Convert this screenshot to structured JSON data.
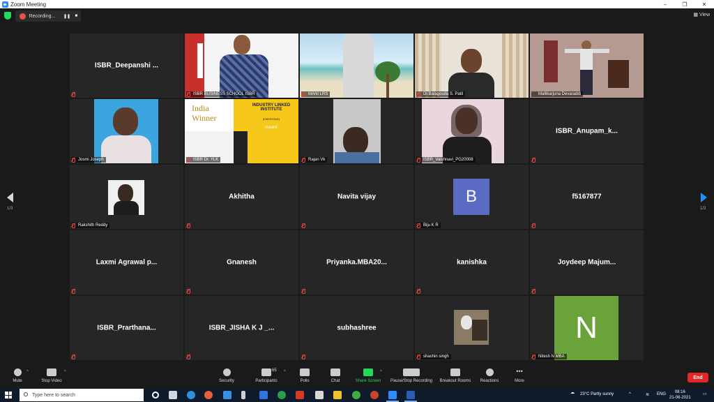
{
  "window": {
    "title": "Zoom Meeting",
    "controls": [
      "–",
      "❐",
      "✕"
    ]
  },
  "recording": {
    "label": "Recording...",
    "pause": "❚❚",
    "stop": "■"
  },
  "view_button": "View",
  "pager": {
    "left": "1/3",
    "right": "1/3"
  },
  "tiles": [
    {
      "center": "ISBR_Deepanshi ...",
      "label": ""
    },
    {
      "center": "",
      "label": "ISBR BUSINESS SCHOOL ISBR"
    },
    {
      "center": "",
      "label": "MANI LRS"
    },
    {
      "center": "",
      "label": "Dr.Balagouda S. Patil"
    },
    {
      "center": "",
      "label": "Mallikarjuna Devaraddi"
    },
    {
      "center": "",
      "label": "Josmi Joseph"
    },
    {
      "center": "",
      "label": "ISBR Dr. YLK",
      "poster_a": "India Winner",
      "poster_b": "INDUSTRY LINKED INSTITUTE",
      "poster_c": "(EMERGING)",
      "poster_d": "Award"
    },
    {
      "center": "",
      "label": "Rajan Vk"
    },
    {
      "center": "",
      "label": "ISBR_Vaishnavi_PG20008"
    },
    {
      "center": "ISBR_Anupam_k...",
      "label": ""
    },
    {
      "center": "",
      "label": "Rakshith Reddy"
    },
    {
      "center": "Akhitha",
      "label": ""
    },
    {
      "center": "Navita vijay",
      "label": ""
    },
    {
      "center": "",
      "label": "Biju K R",
      "avatar": "B"
    },
    {
      "center": "f5167877",
      "label": ""
    },
    {
      "center": "Laxmi Agrawal p...",
      "label": ""
    },
    {
      "center": "Gnanesh",
      "label": ""
    },
    {
      "center": "Priyanka.MBA20...",
      "label": ""
    },
    {
      "center": "kanishka",
      "label": ""
    },
    {
      "center": "Joydeep  Majum...",
      "label": ""
    },
    {
      "center": "ISBR_Prarthana...",
      "label": ""
    },
    {
      "center": "ISBR_JISHA  K J  _...",
      "label": ""
    },
    {
      "center": "subhashree",
      "label": ""
    },
    {
      "center": "",
      "label": "shashin singh"
    },
    {
      "center": "",
      "label": "Nitesh N MBA",
      "avatar": "N"
    }
  ],
  "toolbar": {
    "mute": "Mute",
    "stop_video": "Stop Video",
    "security": "Security",
    "participants": "Participants",
    "participants_count": "65",
    "polls": "Polls",
    "chat": "Chat",
    "share_screen": "Share Screen",
    "recording": "Pause/Stop Recording",
    "breakout": "Breakout Rooms",
    "reactions": "Reactions",
    "more": "More",
    "end": "End"
  },
  "taskbar": {
    "search_placeholder": "Type here to search",
    "weather": "23°C  Partly sunny",
    "lang": "ENG",
    "time": "08:16",
    "date": "21-06-2021"
  },
  "colors": {
    "accent": "#2d8cff",
    "end": "#e02828",
    "active_speaker": "#f1f25c",
    "share": "#23d959"
  }
}
